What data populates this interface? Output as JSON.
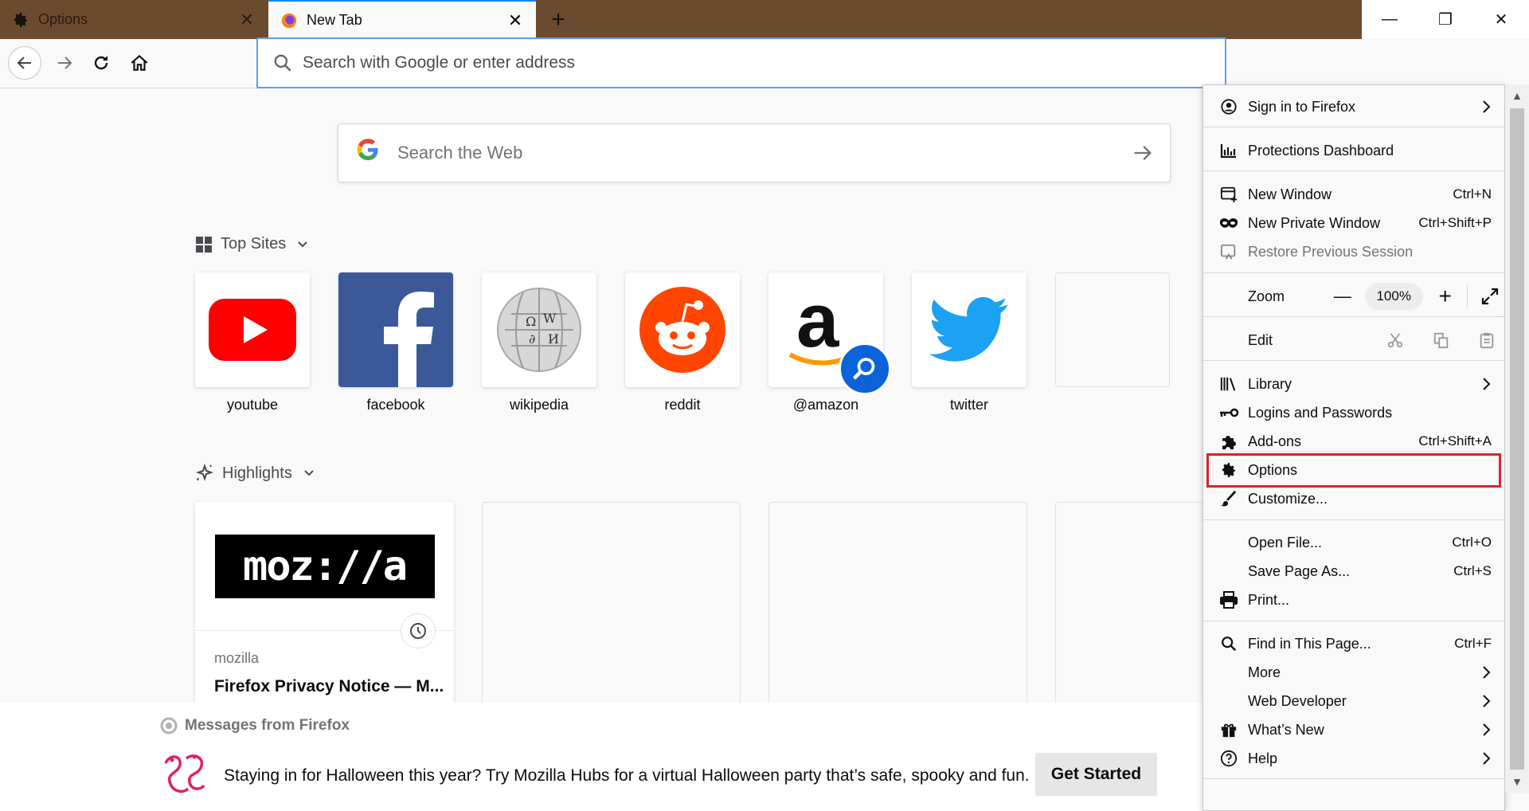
{
  "tabs": [
    {
      "label": "Options",
      "close": "✕"
    },
    {
      "label": "New Tab",
      "close": "✕"
    }
  ],
  "new_tab_symbol": "+",
  "window_controls": {
    "minimize": "—",
    "restore": "❐",
    "close": "✕"
  },
  "urlbar": {
    "placeholder": "Search with Google or enter address"
  },
  "websearch": {
    "logo": "G",
    "placeholder": "Search the Web"
  },
  "top_sites": {
    "title": "Top Sites",
    "sites": [
      {
        "label": "youtube",
        "color": "#ff0000"
      },
      {
        "label": "facebook",
        "color": "#3b5998"
      },
      {
        "label": "wikipedia",
        "color": "#cccccc"
      },
      {
        "label": "reddit",
        "color": "#ff4500"
      },
      {
        "label": "@amazon",
        "color": "#ff9900"
      },
      {
        "label": "twitter",
        "color": "#1da1f2"
      }
    ]
  },
  "highlights": {
    "title": "Highlights",
    "cards": [
      {
        "logo_text": "moz://a",
        "site": "mozilla",
        "title": "Firefox Privacy Notice — M..."
      }
    ]
  },
  "messages": {
    "heading": "Messages from Firefox",
    "text": "Staying in for Halloween this year? Try Mozilla Hubs for a virtual Halloween party that’s safe, spooky and fun.",
    "button": "Get Started"
  },
  "menu": {
    "sign_in": "Sign in to Firefox",
    "protections": "Protections Dashboard",
    "new_window": {
      "label": "New Window",
      "shortcut": "Ctrl+N"
    },
    "new_private": {
      "label": "New Private Window",
      "shortcut": "Ctrl+Shift+P"
    },
    "restore": "Restore Previous Session",
    "zoom": {
      "label": "Zoom",
      "minus": "—",
      "value": "100%",
      "plus": "+"
    },
    "edit": {
      "label": "Edit"
    },
    "library": "Library",
    "logins": "Logins and Passwords",
    "addons": {
      "label": "Add-ons",
      "shortcut": "Ctrl+Shift+A"
    },
    "options": "Options",
    "customize": "Customize...",
    "open_file": {
      "label": "Open File...",
      "shortcut": "Ctrl+O"
    },
    "save_page": {
      "label": "Save Page As...",
      "shortcut": "Ctrl+S"
    },
    "print": "Print...",
    "find": {
      "label": "Find in This Page...",
      "shortcut": "Ctrl+F"
    },
    "more": "More",
    "web_dev": "Web Developer",
    "whats_new": "What’s New",
    "help": "Help"
  },
  "colors": {
    "accent": "#0a84ff",
    "highlight_border": "#e0202a",
    "titlebar": "#6b4b2f"
  }
}
